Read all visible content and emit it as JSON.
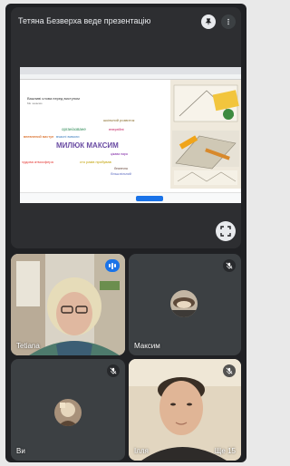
{
  "presentation": {
    "title": "Тетяна Безверха веде презентацію",
    "slide": {
      "heading": "Важливі слова перед виступом",
      "subheading": "Ми чекаємо",
      "words": [
        {
          "text": "МИЛЮК МАКСИМ",
          "color": "#6a4ca3"
        },
        {
          "text": "шкільний розвиток",
          "color": "#8b6f2f"
        },
        {
          "text": "організоване",
          "color": "#2e8b57"
        },
        {
          "text": "енергійні",
          "color": "#c2185b"
        },
        {
          "text": "вчасні вимоги",
          "color": "#3f7fbf"
        },
        {
          "text": "впевнений виступ",
          "color": "#d35400"
        },
        {
          "text": "цікава пара",
          "color": "#7b1fa2"
        },
        {
          "text": "чудова атмосфера",
          "color": "#e53935"
        },
        {
          "text": "сто разів пробував",
          "color": "#c0a000"
        },
        {
          "text": "безпечна",
          "color": "#6d4c41"
        },
        {
          "text": "більш вільний",
          "color": "#5c6bc0"
        }
      ]
    }
  },
  "participants": [
    {
      "name": "Tetiana",
      "state": "speaking"
    },
    {
      "name": "Максим",
      "state": "muted"
    },
    {
      "name": "Ви",
      "state": "muted"
    },
    {
      "name": "Ілля",
      "state": "muted"
    }
  ],
  "more_label": "Ще 15",
  "icons": {
    "mute": "mic-off-icon",
    "fullscreen": "fullscreen-icon",
    "pin": "pin-icon",
    "menu": "more-vert-icon"
  }
}
